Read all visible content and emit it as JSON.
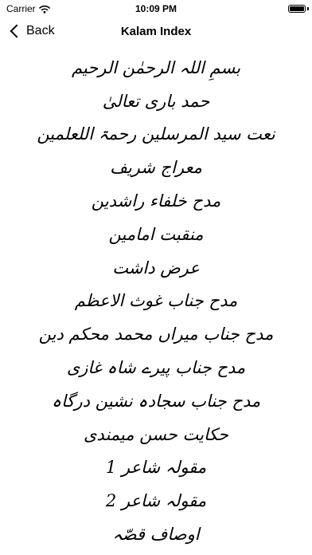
{
  "status_bar": {
    "carrier": "Carrier",
    "time": "10:09 PM",
    "battery_level": 1.0
  },
  "nav": {
    "back_label": "Back",
    "title": "Kalam Index"
  },
  "kalam_items": [
    "بسمِ اللہ الرحمٰن الرحیم",
    "حمد باری تعالیٰ",
    "نعت سید المرسلین رحمۃ اللعلمین",
    "معراج شریف",
    "مدح خلفاء راشدین",
    "منقبت امامین",
    "عرض داشت",
    "مدح جناب غوث الاعظم",
    "مدح جناب میراں محمد محکم دین",
    "مدح جناب پیرے شاہ غازی",
    "مدح جناب سجادہ نشین درگاہ",
    "حکایت حسن میمندی",
    "مقولہ شاعر 1",
    "مقولہ شاعر 2",
    "اوصاف قصّہ"
  ]
}
